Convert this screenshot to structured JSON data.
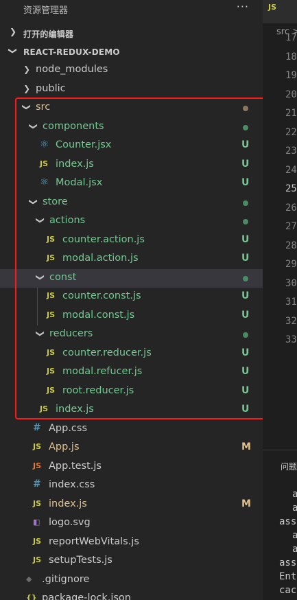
{
  "explorer": {
    "title": "资源管理器",
    "more": "···",
    "open_editors_label": "打开的编辑器",
    "project_label": "REACT-REDUX-DEMO"
  },
  "colors": {
    "folder": "#cccccc",
    "untracked": "#73c991",
    "modified": "#e2c08d",
    "js_icon": "#cbcb41",
    "react_icon": "#519aba",
    "css_icon": "#519aba",
    "test_icon": "#e37933",
    "highlight_box": "#ff1a1a"
  },
  "tree": [
    {
      "label": "node_modules",
      "kind": "folder",
      "open": false,
      "depth": 1,
      "status": ""
    },
    {
      "label": "public",
      "kind": "folder",
      "open": false,
      "depth": 1,
      "status": ""
    },
    {
      "label": "src",
      "kind": "folder",
      "open": true,
      "depth": 1,
      "status": "dot-modified"
    },
    {
      "label": "components",
      "kind": "folder",
      "open": true,
      "depth": 2,
      "status": "dot-untracked"
    },
    {
      "label": "Counter.jsx",
      "kind": "react",
      "depth": 3,
      "status": "U"
    },
    {
      "label": "index.js",
      "kind": "js",
      "depth": 3,
      "status": "U"
    },
    {
      "label": "Modal.jsx",
      "kind": "react",
      "depth": 3,
      "status": "U"
    },
    {
      "label": "store",
      "kind": "folder",
      "open": true,
      "depth": 2,
      "status": "dot-untracked"
    },
    {
      "label": "actions",
      "kind": "folder",
      "open": true,
      "depth": 3,
      "status": "dot-untracked"
    },
    {
      "label": "counter.action.js",
      "kind": "js",
      "depth": 4,
      "status": "U"
    },
    {
      "label": "modal.action.js",
      "kind": "js",
      "depth": 4,
      "status": "U"
    },
    {
      "label": "const",
      "kind": "folder",
      "open": true,
      "depth": 3,
      "status": "dot-untracked",
      "selected": true
    },
    {
      "label": "counter.const.js",
      "kind": "js",
      "depth": 4,
      "status": "U"
    },
    {
      "label": "modal.const.js",
      "kind": "js",
      "depth": 4,
      "status": "U"
    },
    {
      "label": "reducers",
      "kind": "folder",
      "open": true,
      "depth": 3,
      "status": "dot-untracked"
    },
    {
      "label": "counter.reducer.js",
      "kind": "js",
      "depth": 4,
      "status": "U"
    },
    {
      "label": "modal.refucer.js",
      "kind": "js",
      "depth": 4,
      "status": "U"
    },
    {
      "label": "root.reducer.js",
      "kind": "js",
      "depth": 4,
      "status": "U"
    },
    {
      "label": "index.js",
      "kind": "js",
      "depth": 3,
      "status": "U"
    },
    {
      "label": "App.css",
      "kind": "css",
      "depth": 2,
      "status": ""
    },
    {
      "label": "App.js",
      "kind": "js",
      "depth": 2,
      "status": "M"
    },
    {
      "label": "App.test.js",
      "kind": "test",
      "depth": 2,
      "status": ""
    },
    {
      "label": "index.css",
      "kind": "css",
      "depth": 2,
      "status": ""
    },
    {
      "label": "index.js",
      "kind": "js",
      "depth": 2,
      "status": "M"
    },
    {
      "label": "logo.svg",
      "kind": "svg",
      "depth": 2,
      "status": ""
    },
    {
      "label": "reportWebVitals.js",
      "kind": "js",
      "depth": 2,
      "status": ""
    },
    {
      "label": "setupTests.js",
      "kind": "js",
      "depth": 2,
      "status": ""
    },
    {
      "label": ".gitignore",
      "kind": "git",
      "depth": 1,
      "status": ""
    },
    {
      "label": "package-lock.json",
      "kind": "json",
      "depth": 1,
      "status": ""
    }
  ],
  "editor": {
    "tab_icon": "JS",
    "breadcrumb": "src >",
    "line_numbers": [
      "17",
      "18",
      "19",
      "20",
      "21",
      "22",
      "23",
      "24",
      "25",
      "26",
      "27",
      "28",
      "29",
      "30",
      "31",
      "32",
      "33"
    ],
    "active_line": "25",
    "panel_tab": "问题",
    "terminal_lines": [
      "a",
      "a",
      "ass",
      "a",
      "a",
      "ass",
      "Ent",
      "cac"
    ]
  }
}
